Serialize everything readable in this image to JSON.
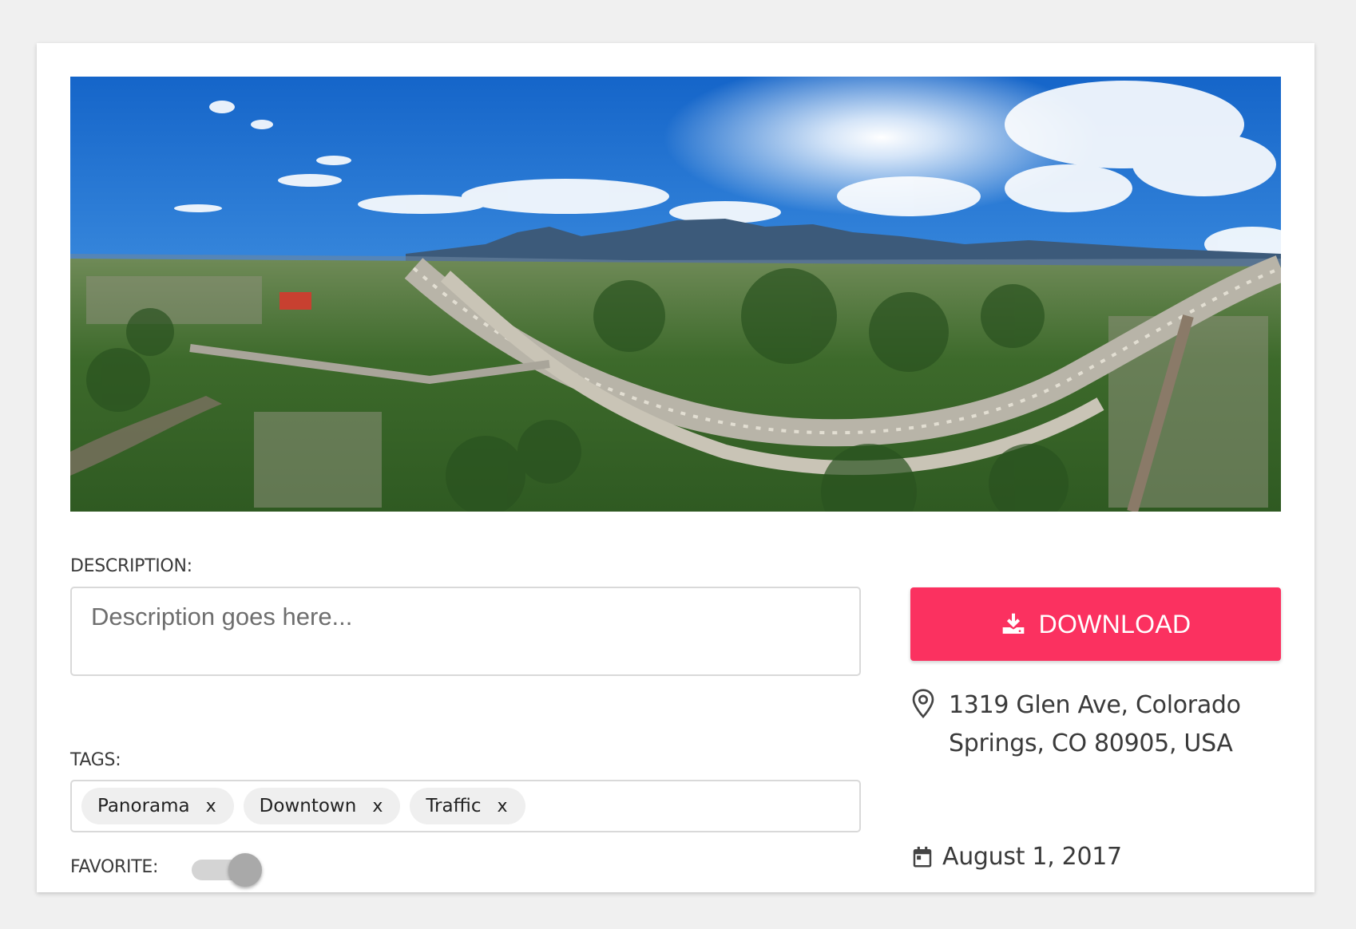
{
  "photo": {
    "alt": "Aerial panorama of Colorado Springs highway with mountains"
  },
  "description": {
    "label": "DESCRIPTION:",
    "placeholder": "Description goes here...",
    "value": ""
  },
  "tags": {
    "label": "TAGS:",
    "remove_glyph": "x",
    "items": [
      {
        "label": "Panorama"
      },
      {
        "label": "Downtown"
      },
      {
        "label": "Traffic"
      }
    ]
  },
  "favorite": {
    "label": "FAVORITE:",
    "on": false
  },
  "download": {
    "label": "DOWNLOAD",
    "icon": "download-icon",
    "color": "#fb3160"
  },
  "location": {
    "icon": "location-pin-icon",
    "address": "1319 Glen Ave, Colorado Springs, CO 80905, USA"
  },
  "date": {
    "icon": "calendar-icon",
    "text": "August 1, 2017"
  }
}
